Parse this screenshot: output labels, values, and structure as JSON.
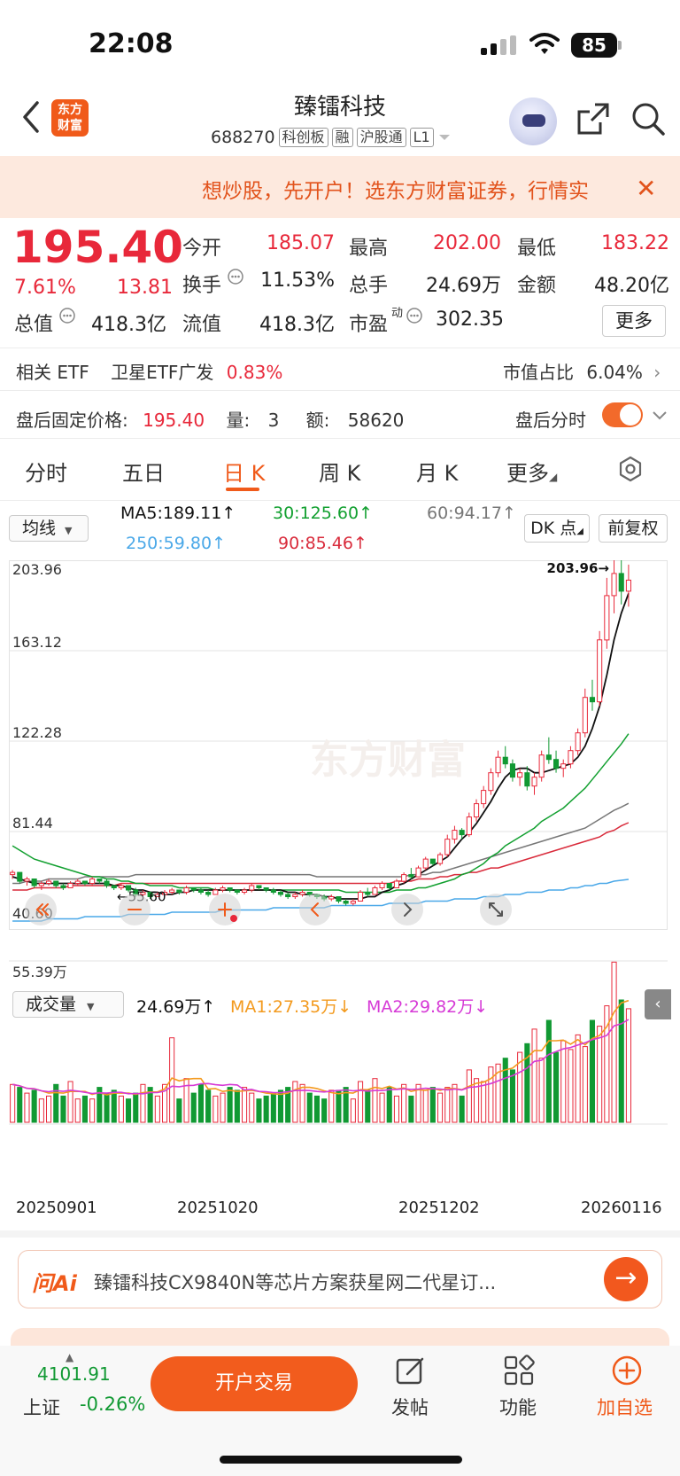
{
  "status_bar": {
    "time": "22:08",
    "battery": "85"
  },
  "header": {
    "title": "臻镭科技",
    "code": "688270",
    "tags": [
      "科创板",
      "融",
      "沪股通",
      "L1"
    ],
    "logo_text": [
      "东方",
      "财富"
    ]
  },
  "banner": {
    "text": "想炒股，先开户！选东方财富证券，行情实"
  },
  "quote": {
    "price": "195.40",
    "change_pct": "7.61%",
    "change": "13.81",
    "fields": [
      {
        "label": "今开",
        "value": "185.07",
        "color": "#e8283a"
      },
      {
        "label": "最高",
        "value": "202.00",
        "color": "#e8283a"
      },
      {
        "label": "最低",
        "value": "183.22",
        "color": "#e8283a"
      },
      {
        "label": "换手",
        "value": "11.53%",
        "color": "#222222"
      },
      {
        "label": "总手",
        "value": "24.69万",
        "color": "#222222"
      },
      {
        "label": "金额",
        "value": "48.20亿",
        "color": "#222222"
      },
      {
        "label": "总值",
        "value": "418.3亿",
        "color": "#222222"
      },
      {
        "label": "流值",
        "value": "418.3亿",
        "color": "#222222"
      },
      {
        "label": "市盈",
        "value": "302.35",
        "color": "#222222"
      }
    ],
    "pe_superscript": "动",
    "more_label": "更多"
  },
  "etf": {
    "label": "相关 ETF",
    "name": "卫星ETF广发",
    "pct": "0.83%",
    "ratio_label": "市值占比",
    "ratio": "6.04%"
  },
  "after_hours": {
    "price_label": "盘后固定价格:",
    "price": "195.40",
    "vol_label": "量:",
    "vol": "3",
    "amt_label": "额:",
    "amt": "58620",
    "toggle_label": "盘后分时"
  },
  "tabs": [
    "分时",
    "五日",
    "日 K",
    "周 K",
    "月 K",
    "更多"
  ],
  "active_tab": "日 K",
  "ma": {
    "select_label": "均线",
    "ma5": "MA5:189.11",
    "ma30": "30:125.60",
    "ma60": "60:94.17",
    "ma250": "250:59.80",
    "ma90": "90:85.46",
    "dk_label": "DK 点",
    "fq_label": "前复权",
    "colors": {
      "ma5": "#111111",
      "ma30": "#12a030",
      "ma60": "#777777",
      "ma250": "#4aa8e8",
      "ma90": "#d92b3b"
    }
  },
  "chart_data": {
    "type": "candlestick",
    "y_ticks": [
      "203.96",
      "163.12",
      "122.28",
      "81.44",
      "40.60"
    ],
    "ylim": [
      40.6,
      203.96
    ],
    "max_label": "203.96",
    "min_label": "55.60",
    "watermark": "东方财富",
    "up_color": "#e8283a",
    "down_color": "#119933",
    "candles": [
      [
        62,
        64,
        60,
        63
      ],
      [
        63,
        63,
        58,
        59
      ],
      [
        59,
        61,
        57,
        60
      ],
      [
        60,
        60,
        56,
        57
      ],
      [
        57,
        59,
        55,
        58
      ],
      [
        58,
        60,
        57,
        59
      ],
      [
        59,
        59,
        56,
        57
      ],
      [
        57,
        58,
        55,
        56
      ],
      [
        56,
        59,
        56,
        58
      ],
      [
        58,
        60,
        57,
        59
      ],
      [
        59,
        59,
        57,
        58
      ],
      [
        58,
        61,
        57,
        60
      ],
      [
        60,
        60,
        58,
        59
      ],
      [
        59,
        60,
        56,
        57
      ],
      [
        57,
        57,
        55,
        56
      ],
      [
        56,
        58,
        55,
        57
      ],
      [
        57,
        57,
        54,
        55
      ],
      [
        55,
        56,
        52,
        53
      ],
      [
        53,
        55,
        52,
        54
      ],
      [
        54,
        54,
        51,
        52
      ],
      [
        52,
        54,
        52,
        53
      ],
      [
        53,
        55,
        52,
        54
      ],
      [
        54,
        56,
        53,
        55
      ],
      [
        55,
        55,
        53,
        54
      ],
      [
        54,
        57,
        53,
        56
      ],
      [
        56,
        56,
        54,
        55
      ],
      [
        55,
        56,
        53,
        54
      ],
      [
        54,
        55,
        52,
        53
      ],
      [
        53,
        56,
        53,
        55
      ],
      [
        55,
        57,
        54,
        56
      ],
      [
        56,
        56,
        54,
        55
      ],
      [
        55,
        55,
        53,
        54
      ],
      [
        54,
        56,
        53,
        55
      ],
      [
        55,
        58,
        54,
        57
      ],
      [
        57,
        57,
        55,
        56
      ],
      [
        56,
        56,
        54,
        55
      ],
      [
        55,
        56,
        53,
        54
      ],
      [
        54,
        55,
        52,
        53
      ],
      [
        53,
        54,
        51,
        52
      ],
      [
        52,
        54,
        51,
        53
      ],
      [
        53,
        55,
        52,
        54
      ],
      [
        54,
        54,
        52,
        53
      ],
      [
        53,
        53,
        51,
        52
      ],
      [
        52,
        53,
        50,
        51
      ],
      [
        51,
        53,
        50,
        52
      ],
      [
        52,
        52,
        49,
        50
      ],
      [
        50,
        51,
        48,
        49
      ],
      [
        49,
        51,
        48,
        50
      ],
      [
        50,
        55,
        50,
        54
      ],
      [
        54,
        56,
        52,
        53
      ],
      [
        53,
        57,
        53,
        56
      ],
      [
        56,
        59,
        55,
        58
      ],
      [
        58,
        58,
        55,
        56
      ],
      [
        56,
        60,
        56,
        59
      ],
      [
        59,
        63,
        58,
        62
      ],
      [
        62,
        65,
        60,
        61
      ],
      [
        61,
        66,
        61,
        65
      ],
      [
        65,
        70,
        64,
        69
      ],
      [
        69,
        69,
        66,
        67
      ],
      [
        67,
        72,
        66,
        71
      ],
      [
        71,
        80,
        70,
        78
      ],
      [
        78,
        84,
        76,
        82
      ],
      [
        82,
        83,
        78,
        80
      ],
      [
        80,
        90,
        79,
        88
      ],
      [
        88,
        96,
        86,
        94
      ],
      [
        94,
        102,
        92,
        100
      ],
      [
        100,
        110,
        98,
        108
      ],
      [
        108,
        118,
        106,
        115
      ],
      [
        115,
        120,
        110,
        112
      ],
      [
        112,
        114,
        104,
        106
      ],
      [
        106,
        110,
        102,
        108
      ],
      [
        108,
        111,
        100,
        102
      ],
      [
        102,
        108,
        98,
        106
      ],
      [
        106,
        118,
        104,
        116
      ],
      [
        116,
        124,
        112,
        114
      ],
      [
        114,
        118,
        108,
        110
      ],
      [
        110,
        114,
        106,
        112
      ],
      [
        112,
        120,
        110,
        118
      ],
      [
        118,
        128,
        116,
        126
      ],
      [
        126,
        146,
        124,
        142
      ],
      [
        142,
        150,
        136,
        140
      ],
      [
        140,
        172,
        138,
        168
      ],
      [
        168,
        196,
        164,
        188
      ],
      [
        188,
        204,
        180,
        198
      ],
      [
        198,
        204,
        184,
        190
      ],
      [
        190,
        202,
        183,
        195
      ]
    ],
    "ma5": [
      61,
      60,
      59,
      58,
      58,
      58,
      58,
      58,
      58,
      58,
      58,
      58,
      58,
      58,
      57,
      57,
      56,
      55,
      55,
      54,
      54,
      53,
      53,
      54,
      54,
      55,
      55,
      55,
      55,
      55,
      55,
      55,
      55,
      55,
      55,
      55,
      55,
      55,
      54,
      54,
      53,
      53,
      53,
      52,
      52,
      51,
      51,
      51,
      51,
      52,
      52,
      54,
      55,
      57,
      58,
      60,
      62,
      64,
      66,
      68,
      70,
      74,
      78,
      81,
      85,
      90,
      95,
      101,
      106,
      109,
      110,
      110,
      108,
      108,
      109,
      110,
      111,
      112,
      115,
      120,
      128,
      138,
      152,
      168,
      180,
      189
    ],
    "ma30": [
      75,
      73,
      71,
      69,
      68,
      67,
      66,
      65,
      64,
      63,
      62,
      61,
      61,
      60,
      60,
      59,
      59,
      58,
      58,
      57,
      57,
      57,
      57,
      56,
      56,
      56,
      56,
      56,
      55,
      55,
      55,
      55,
      55,
      55,
      55,
      55,
      55,
      55,
      55,
      55,
      55,
      55,
      55,
      55,
      55,
      55,
      54,
      54,
      54,
      54,
      54,
      54,
      54,
      55,
      55,
      55,
      56,
      56,
      57,
      58,
      59,
      60,
      62,
      63,
      65,
      67,
      70,
      72,
      75,
      77,
      79,
      81,
      83,
      86,
      88,
      90,
      92,
      95,
      98,
      101,
      105,
      109,
      113,
      117,
      121,
      125.6
    ],
    "ma60": [
      58,
      58,
      59,
      59,
      59,
      60,
      60,
      60,
      60,
      60,
      61,
      61,
      61,
      61,
      61,
      61,
      61,
      62,
      62,
      62,
      62,
      62,
      62,
      62,
      62,
      62,
      62,
      62,
      62,
      62,
      62,
      62,
      62,
      62,
      62,
      62,
      62,
      62,
      62,
      62,
      62,
      62,
      61,
      61,
      61,
      61,
      61,
      61,
      61,
      61,
      61,
      61,
      61,
      61,
      61,
      62,
      62,
      62,
      63,
      63,
      64,
      65,
      66,
      67,
      68,
      69,
      70,
      71,
      72,
      73,
      74,
      75,
      76,
      77,
      78,
      79,
      80,
      81,
      82,
      83,
      85,
      87,
      89,
      91,
      92.5,
      94.17
    ],
    "ma90": [
      55,
      55,
      55,
      56,
      56,
      56,
      56,
      56,
      57,
      57,
      57,
      57,
      57,
      57,
      57,
      58,
      58,
      58,
      58,
      58,
      58,
      58,
      58,
      58,
      58,
      58,
      58,
      58,
      58,
      58,
      58,
      58,
      58,
      58,
      58,
      58,
      58,
      58,
      58,
      58,
      58,
      58,
      58,
      58,
      58,
      58,
      58,
      58,
      58,
      58,
      58,
      58,
      58,
      59,
      59,
      59,
      60,
      60,
      60,
      61,
      61,
      62,
      62,
      63,
      63,
      64,
      65,
      65,
      66,
      67,
      68,
      69,
      70,
      71,
      72,
      73,
      74,
      75,
      76,
      77,
      78,
      79,
      81,
      82,
      84,
      85.46
    ],
    "ma250": [
      41,
      41,
      41,
      41,
      41,
      42,
      42,
      42,
      42,
      42,
      43,
      43,
      43,
      43,
      43,
      43,
      44,
      44,
      44,
      44,
      44,
      44,
      45,
      45,
      45,
      45,
      45,
      45,
      45,
      46,
      46,
      46,
      46,
      46,
      46,
      46,
      47,
      47,
      47,
      47,
      47,
      47,
      47,
      47,
      48,
      48,
      48,
      48,
      48,
      48,
      48,
      48,
      49,
      49,
      49,
      49,
      49,
      50,
      50,
      50,
      50,
      51,
      51,
      51,
      51,
      52,
      52,
      52,
      53,
      53,
      53,
      54,
      54,
      54,
      55,
      55,
      55,
      56,
      56,
      57,
      57,
      58,
      58,
      59,
      59.4,
      59.8
    ]
  },
  "volume": {
    "select_label": "成交量",
    "current": "24.69万",
    "ma1": "MA1:27.35万",
    "ma2": "MA2:29.82万",
    "max_label": "55.39万",
    "ma1_color": "#f39a1e",
    "ma2_color": "#d63ad6",
    "values": [
      13,
      12,
      10,
      11,
      8,
      9,
      13,
      9,
      14,
      8,
      9,
      8,
      12,
      10,
      11,
      9,
      8,
      10,
      13,
      12,
      9,
      13,
      29,
      8,
      15,
      10,
      13,
      11,
      9,
      10,
      12,
      11,
      12,
      10,
      8,
      9,
      10,
      11,
      12,
      14,
      13,
      10,
      9,
      8,
      11,
      11,
      12,
      8,
      14,
      11,
      15,
      10,
      12,
      9,
      13,
      9,
      13,
      11,
      12,
      10,
      12,
      13,
      9,
      18,
      15,
      14,
      19,
      20,
      22,
      18,
      24,
      27,
      32,
      22,
      35,
      24,
      28,
      25,
      30,
      26,
      35,
      33,
      40,
      55,
      42,
      39
    ]
  },
  "date_axis": [
    "20250901",
    "20251020",
    "20251202",
    "20260116"
  ],
  "ai_news": {
    "logo": "问Ai",
    "text": "臻镭科技CX9840N等芯片方案获星网二代星订..."
  },
  "bottom_bar": {
    "index_value": "4101.91",
    "index_name": "上证",
    "index_change": "-0.26%",
    "trade_label": "开户交易",
    "post_label": "发帖",
    "func_label": "功能",
    "watch_label": "加自选"
  }
}
